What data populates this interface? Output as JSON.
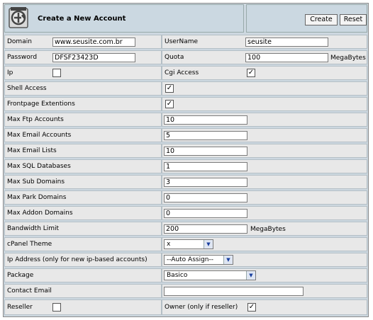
{
  "header": {
    "title": "Create a New Account",
    "create_label": "Create",
    "reset_label": "Reset"
  },
  "domain": {
    "label": "Domain",
    "value": "www.seusite.com.br"
  },
  "username": {
    "label": "UserName",
    "value": "seusite"
  },
  "password": {
    "label": "Password",
    "value": "DFSF23423D"
  },
  "quota": {
    "label": "Quota",
    "value": "100",
    "unit": "MegaBytes"
  },
  "ip": {
    "label": "Ip",
    "checked": false
  },
  "cgi_access": {
    "label": "Cgi Access",
    "checked": true,
    "mark": "✓"
  },
  "shell_access": {
    "label": "Shell Access",
    "checked": true,
    "mark": "✓"
  },
  "frontpage": {
    "label": "Frontpage Extentions",
    "checked": true,
    "mark": "✓"
  },
  "max_ftp": {
    "label": "Max Ftp Accounts",
    "value": "10"
  },
  "max_email_accounts": {
    "label": "Max Email Accounts",
    "value": "5"
  },
  "max_email_lists": {
    "label": "Max Email Lists",
    "value": "10"
  },
  "max_sql": {
    "label": "Max SQL Databases",
    "value": "1"
  },
  "max_sub": {
    "label": "Max Sub Domains",
    "value": "3"
  },
  "max_park": {
    "label": "Max Park Domains",
    "value": "0"
  },
  "max_addon": {
    "label": "Max Addon Domains",
    "value": "0"
  },
  "bandwidth": {
    "label": "Bandwidth Limit",
    "value": "200",
    "unit": "MegaBytes"
  },
  "theme": {
    "label": "cPanel Theme",
    "value": "x"
  },
  "ip_address": {
    "label": "Ip Address (only for new ip-based accounts)",
    "value": "--Auto Assign--"
  },
  "package": {
    "label": "Package",
    "value": "Basico"
  },
  "contact_email": {
    "label": "Contact Email",
    "value": ""
  },
  "reseller": {
    "label": "Reseller",
    "checked": false,
    "owner_label": "Owner (only if reseller)",
    "owner_checked": true,
    "owner_mark": "✓"
  }
}
